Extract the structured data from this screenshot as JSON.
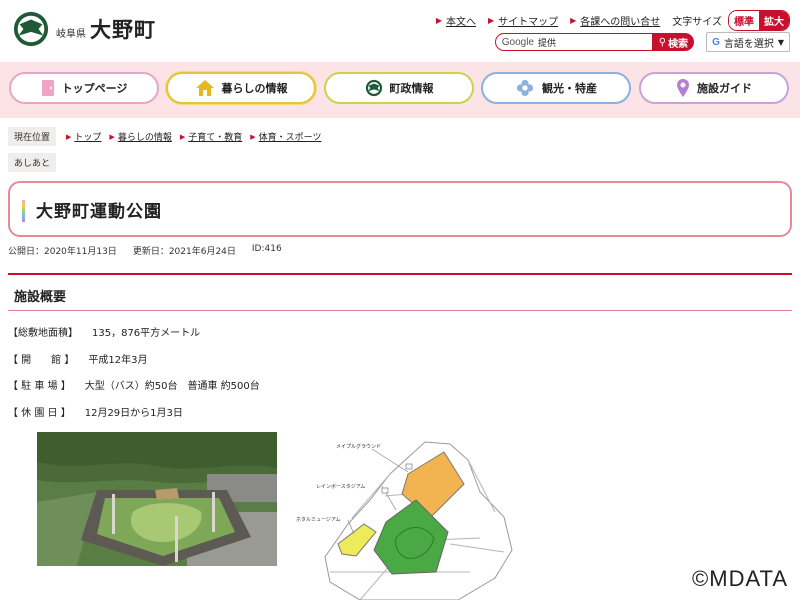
{
  "header": {
    "prefecture": "岐阜県",
    "town": "大野町",
    "links": [
      "本文へ",
      "サイトマップ",
      "各課への問い合せ"
    ],
    "font_size_label": "文字サイズ",
    "font_size_standard": "標準",
    "font_size_large": "拡大",
    "search_brand": "Google",
    "search_placeholder": "提供",
    "search_button": "検索",
    "translate_label": "言語を選択"
  },
  "nav": [
    {
      "label": "トップページ",
      "icon": "door-icon"
    },
    {
      "label": "暮らしの情報",
      "icon": "house-icon"
    },
    {
      "label": "町政情報",
      "icon": "town-emblem-icon"
    },
    {
      "label": "観光・特産",
      "icon": "flower-icon"
    },
    {
      "label": "施設ガイド",
      "icon": "location-pin-icon"
    }
  ],
  "breadcrumb": {
    "tag": "現在位置",
    "items": [
      "トップ",
      "暮らしの情報",
      "子育て・教育",
      "体育・スポーツ"
    ]
  },
  "ashiato": "あしあと",
  "page": {
    "title": "大野町運動公園",
    "published": "公開日：2020年11月13日",
    "updated": "更新日：2021年6月24日",
    "id": "ID:416"
  },
  "section": {
    "heading": "施設概要",
    "rows": [
      {
        "label": "【総敷地面積】",
        "value": "135，876平方メートル"
      },
      {
        "label": "【 開　　館 】",
        "value": "平成12年3月"
      },
      {
        "label": "【 駐 車 場 】",
        "value": "大型（バス）約50台　普通車 約500台"
      },
      {
        "label": "【 休 園 日 】",
        "value": "12月29日から1月3日"
      }
    ]
  },
  "map": {
    "labels": [
      "メイプルグラウンド",
      "レインボースタジアム",
      "ホタルミュージアム"
    ]
  },
  "watermark": "©MDATA",
  "colors": {
    "accent": "#c8102e",
    "nav_background": "#fbe3e6",
    "map_orange": "#f2b451",
    "map_green": "#4aa845",
    "map_yellow": "#eeeb5a"
  }
}
